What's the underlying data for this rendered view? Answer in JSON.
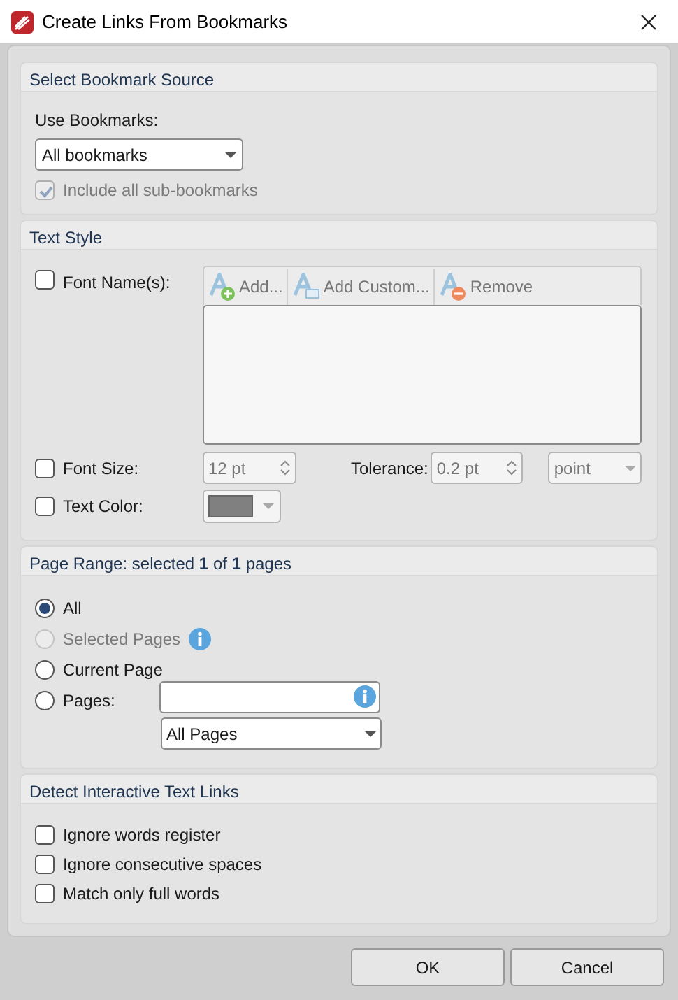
{
  "window": {
    "title": "Create Links From Bookmarks"
  },
  "bookmark_source": {
    "heading": "Select Bookmark Source",
    "label": "Use Bookmarks:",
    "dropdown": "All bookmarks",
    "include_sub": {
      "label": "Include all sub-bookmarks",
      "checked": true,
      "disabled": true
    }
  },
  "text_style": {
    "heading": "Text Style",
    "disabled": true,
    "font_names": {
      "label": "Font Name(s):",
      "checked": false
    },
    "toolbar": [
      {
        "label": "Add...",
        "kind": "add"
      },
      {
        "label": "Add Custom...",
        "kind": "custom"
      },
      {
        "label": "Remove",
        "kind": "remove"
      }
    ],
    "font_size": {
      "label": "Font Size:",
      "checked": false,
      "value": "12 pt"
    },
    "tolerance": {
      "label": "Tolerance:",
      "value": "0.2 pt",
      "unit": "point"
    },
    "text_color": {
      "label": "Text Color:",
      "checked": false,
      "color": "#808080"
    }
  },
  "page_range": {
    "heading": "Page Range: selected **1** of **1** pages",
    "options": [
      {
        "label": "All",
        "selected": true,
        "disabled": false,
        "info": false
      },
      {
        "label": "Selected Pages",
        "selected": false,
        "disabled": true,
        "info": true
      },
      {
        "label": "Current Page",
        "selected": false,
        "disabled": false,
        "info": false
      },
      {
        "label": "Pages:",
        "selected": false,
        "disabled": false,
        "info": false
      }
    ],
    "subset": "All Pages"
  },
  "detect_links": {
    "heading": "Detect Interactive Text Links",
    "options": [
      {
        "label": "Ignore words register",
        "checked": false
      },
      {
        "label": "Ignore consecutive spaces",
        "checked": false
      },
      {
        "label": "Match only full words",
        "checked": false
      }
    ]
  },
  "buttons": [
    {
      "label": "OK"
    },
    {
      "label": "Cancel"
    }
  ]
}
